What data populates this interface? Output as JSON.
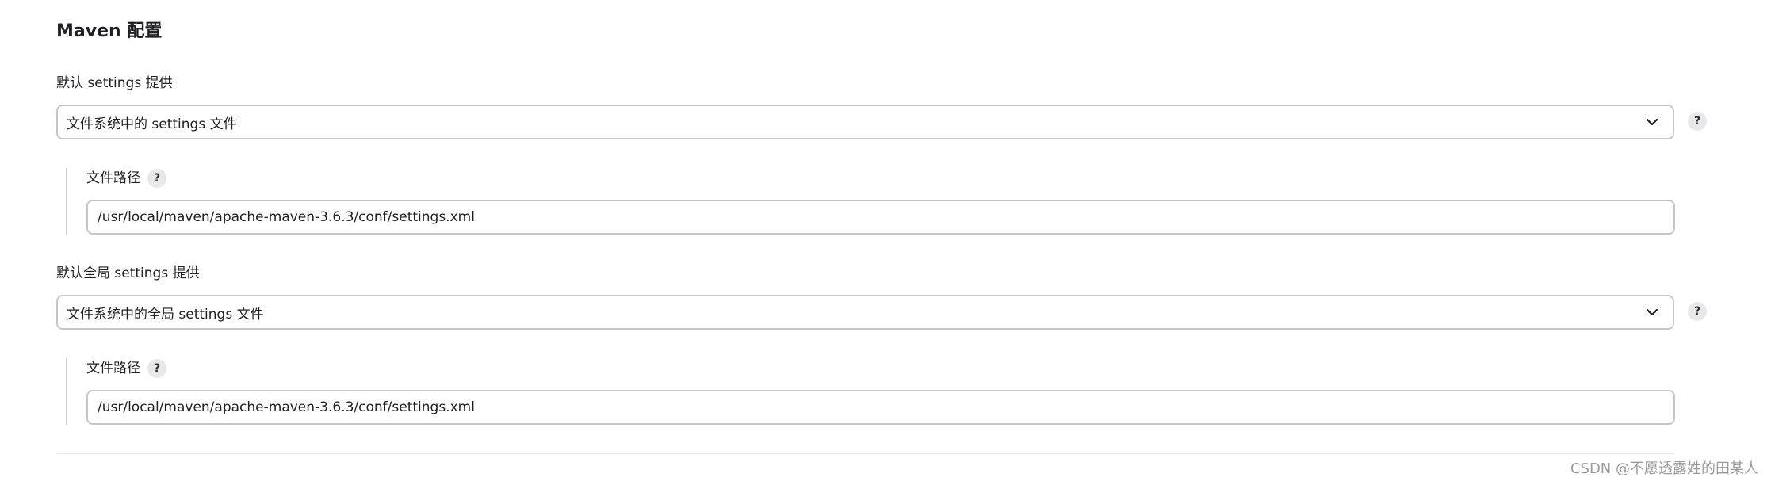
{
  "section": {
    "title": "Maven 配置"
  },
  "settings": {
    "label": "默认 settings 提供",
    "select_value": "文件系统中的 settings 文件",
    "help": "?",
    "path": {
      "label": "文件路径",
      "help": "?",
      "value": "/usr/local/maven/apache-maven-3.6.3/conf/settings.xml"
    }
  },
  "global_settings": {
    "label": "默认全局 settings 提供",
    "select_value": "文件系统中的全局 settings 文件",
    "help": "?",
    "path": {
      "label": "文件路径",
      "help": "?",
      "value": "/usr/local/maven/apache-maven-3.6.3/conf/settings.xml"
    }
  },
  "watermark": "CSDN @不愿透露姓的田某人",
  "icons": {
    "dropdown": "chevron-down-icon",
    "help": "help-icon"
  }
}
